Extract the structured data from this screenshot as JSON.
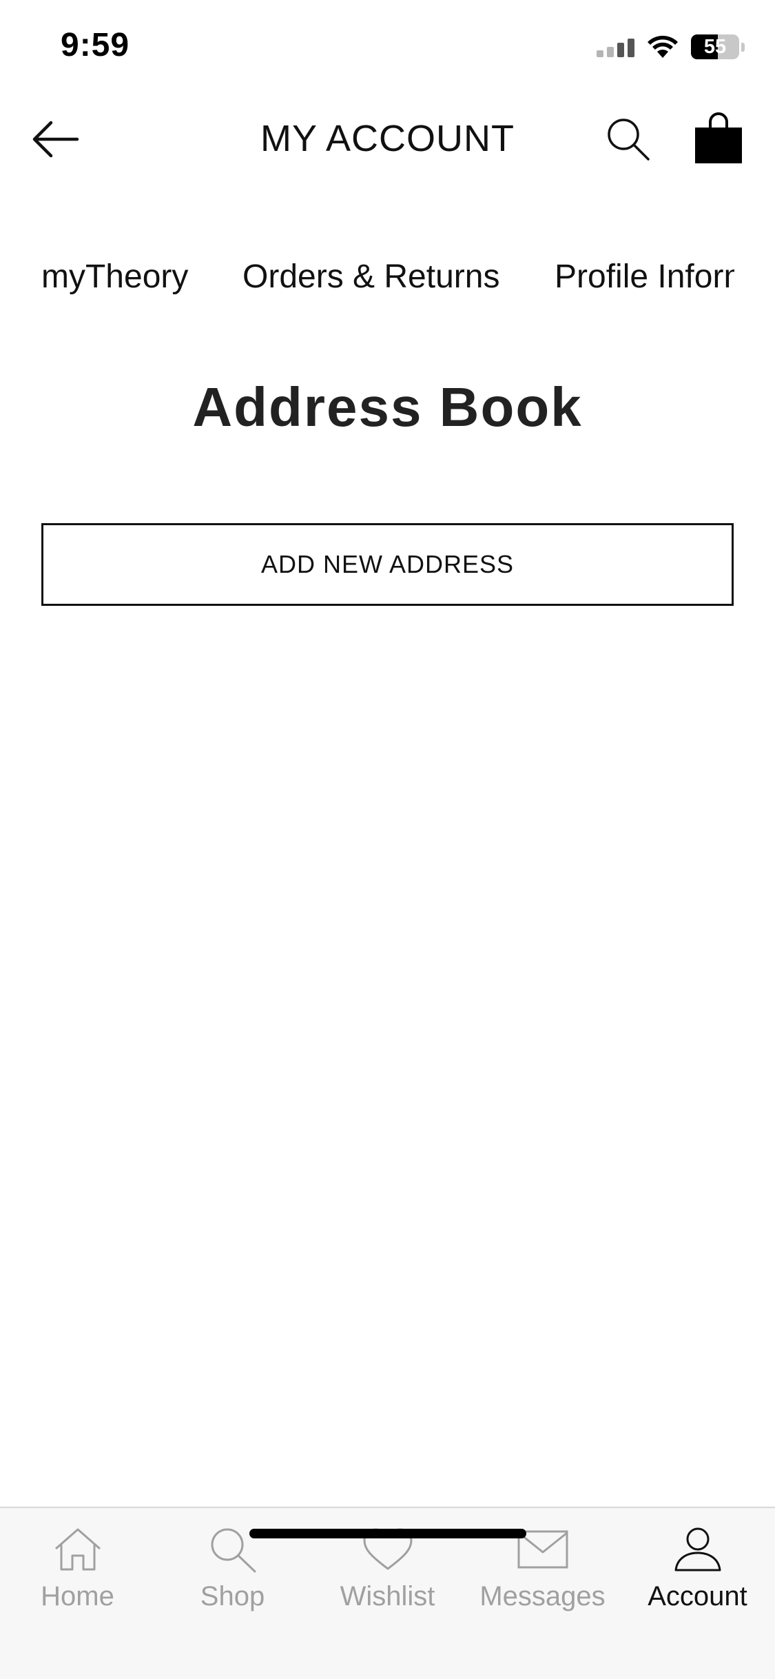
{
  "status_bar": {
    "time": "9:59",
    "battery_percent": 55,
    "battery_label": "55",
    "icons": [
      "cellular-signal-icon",
      "wifi-icon",
      "battery-icon"
    ]
  },
  "header": {
    "title": "MY ACCOUNT",
    "back_icon": "arrow-left-icon",
    "search_icon": "search-icon",
    "bag_icon": "shopping-bag-icon"
  },
  "account_nav": {
    "items": [
      {
        "label": "myTheory"
      },
      {
        "label": "Orders & Returns"
      },
      {
        "label": "Profile Information"
      }
    ]
  },
  "main": {
    "title": "Address Book",
    "add_address_label": "ADD NEW ADDRESS"
  },
  "tab_bar": {
    "items": [
      {
        "label": "Home",
        "icon": "home-icon",
        "active": false
      },
      {
        "label": "Shop",
        "icon": "search-icon",
        "active": false
      },
      {
        "label": "Wishlist",
        "icon": "heart-icon",
        "active": false
      },
      {
        "label": "Messages",
        "icon": "envelope-icon",
        "active": false
      },
      {
        "label": "Account",
        "icon": "user-icon",
        "active": true
      }
    ]
  },
  "colors": {
    "text": "#111111",
    "inactive_tab": "#a0a0a0",
    "tab_bar_bg": "#f7f7f7",
    "background": "#ffffff"
  }
}
